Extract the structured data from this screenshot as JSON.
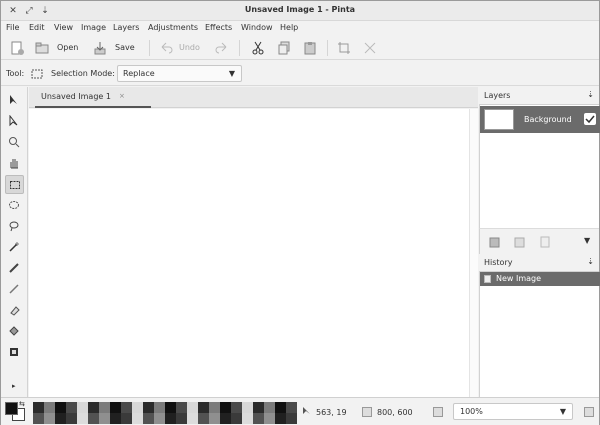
{
  "window": {
    "title": "Unsaved Image 1 - Pinta"
  },
  "menu": [
    "File",
    "Edit",
    "View",
    "Image",
    "Layers",
    "Adjustments",
    "Effects",
    "Window",
    "Help"
  ],
  "toolbar": {
    "open_label": "Open",
    "save_label": "Save",
    "undo_label": "Undo"
  },
  "options": {
    "tool_label": "Tool:",
    "selection_mode_label": "Selection Mode:",
    "selection_mode_value": "Replace"
  },
  "document": {
    "tab_title": "Unsaved Image 1",
    "tab_close": "×"
  },
  "layers": {
    "header": "Layers",
    "items": [
      {
        "name": "Background",
        "visible": true
      }
    ]
  },
  "history": {
    "header": "History",
    "items": [
      "New Image"
    ]
  },
  "status": {
    "cursor_position": "563, 19",
    "image_size": "800, 600",
    "zoom": "100%"
  },
  "palette_shades": [
    "#2b2b2b",
    "#3a3a3a",
    "#cfcfcf",
    "#7b7b7b",
    "#dcdcdc",
    "#ececec",
    "#101010",
    "#525252",
    "#1b1b1b",
    "#4a4a4a",
    "#8f8f8f",
    "#b8b8b8",
    "#d8d8d8",
    "#202020",
    "#606060"
  ]
}
